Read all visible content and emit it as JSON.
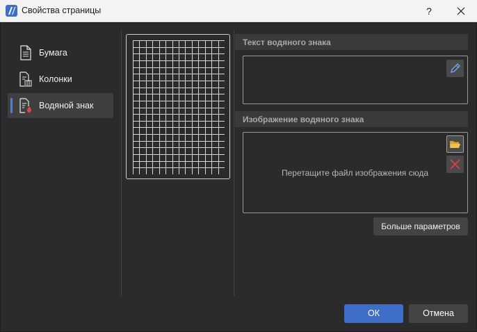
{
  "window": {
    "title": "Свойства страницы",
    "help_label": "?",
    "close_label": "✕"
  },
  "sidebar": {
    "items": [
      {
        "label": "Бумага",
        "icon": "page-icon",
        "active": false
      },
      {
        "label": "Колонки",
        "icon": "columns-icon",
        "active": false
      },
      {
        "label": "Водяной знак",
        "icon": "watermark-icon",
        "active": true
      }
    ]
  },
  "watermark": {
    "text_section_title": "Текст водяного знака",
    "image_section_title": "Изображение водяного знака",
    "drop_hint": "Перетащите файл изображения сюда",
    "more_button": "Больше параметров"
  },
  "footer": {
    "ok": "ОК",
    "cancel": "Отмена"
  },
  "colors": {
    "accent": "#4f81d8",
    "primary_button": "#3f6ec8",
    "background": "#2b2b2b",
    "delete_icon": "#e04040"
  }
}
